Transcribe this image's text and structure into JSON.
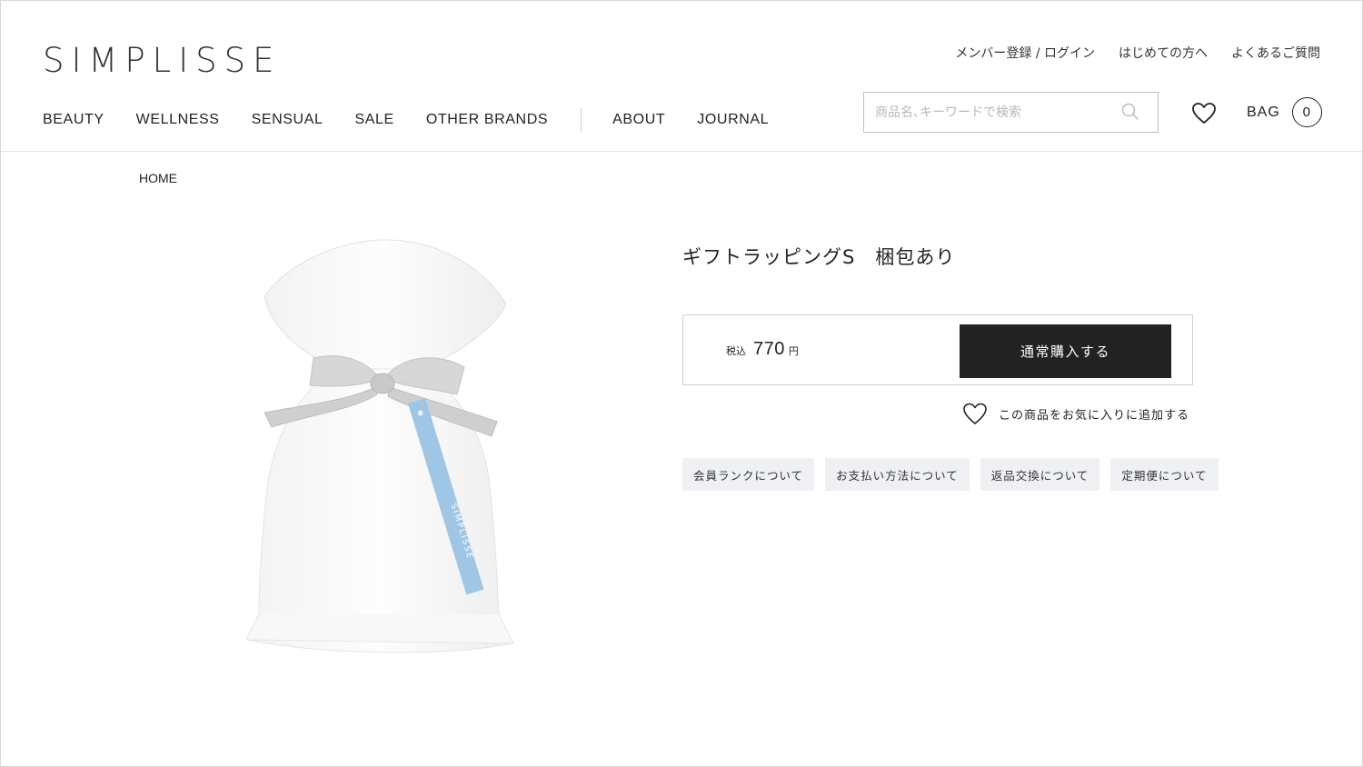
{
  "header": {
    "logo": "SIMPLISSE",
    "util_links": [
      "メンバー登録 / ログイン",
      "はじめての方へ",
      "よくあるご質問"
    ],
    "nav_main": [
      "BEAUTY",
      "WELLNESS",
      "SENSUAL",
      "SALE",
      "OTHER BRANDS"
    ],
    "nav_secondary": [
      "ABOUT",
      "JOURNAL"
    ],
    "search_placeholder": "商品名､キーワードで検索",
    "bag_label": "BAG",
    "bag_count": "0"
  },
  "breadcrumb": "HOME",
  "product": {
    "title": "ギフトラッピングS　梱包あり",
    "tax_label": "税込",
    "price": "770",
    "currency": "円",
    "buy_label": "通常購入する",
    "favorite_label": "この商品をお気に入りに追加する",
    "tag_text": "SIMPLISSE",
    "info_chips": [
      "会員ランクについて",
      "お支払い方法について",
      "返品交換について",
      "定期便について"
    ]
  },
  "colors": {
    "accent": "#222222",
    "chip_bg": "#eef0f3",
    "tag_blue": "#9fc6e5"
  }
}
